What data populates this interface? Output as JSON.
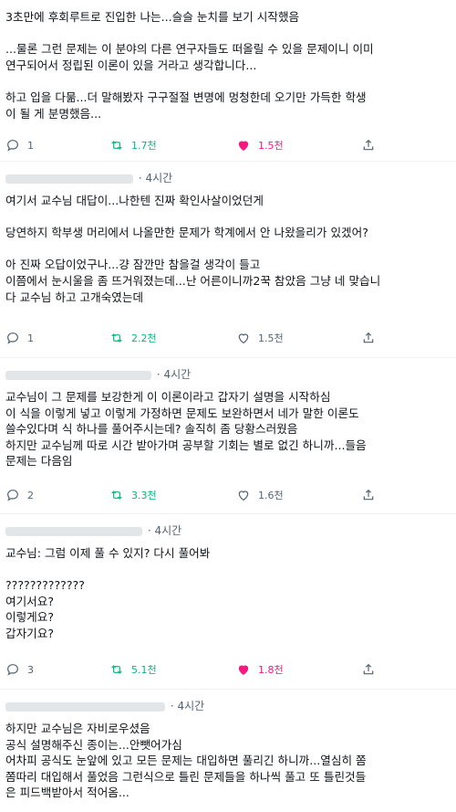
{
  "posts": [
    {
      "text": "3초만에 후회루트로 진입한 나는...슬슬 눈치를 보기 시작했음\n\n...물론 그런 문제는 이 분야의 다른 연구자들도 떠올릴 수 있을 문제이니 이미\n연구되어서 정립된 이론이 있을 거라고 생각합니다...\n\n하고 입을 다묾...더 말해봤자 구구절절 변명에 멍청한데 오기만 가득한 학생\n이 될 게 분명했음...",
      "replies": "1",
      "retweets": "1.7천",
      "likes": "1.5천",
      "liked": true
    },
    {
      "time": "· 4시간",
      "text": "여기서 교수님 대답이...나한텐 진짜 확인사살이었던게\n\n당연하지 학부생 머리에서 나올만한 문제가 학계에서 안 나왔을리가 있겠어?\n\n아 진짜 오답이었구나...걍 잠깐만 참을걸 생각이 들고\n이쯤에서 눈시울을 좀 뜨거워졌는데...난 어른이니까2꾹 참았음 그냥 네 맞습니\n다 교수님 하고 고개숙였는데",
      "replies": "1",
      "retweets": "2.2천",
      "likes": "1.5천",
      "liked": false
    },
    {
      "time": "· 4시간",
      "text": "교수님이 그 문제를 보강한게 이 이론이라고 갑자기 설명을 시작하심\n이 식을 이렇게 넣고 이렇게 가정하면 문제도 보완하면서 네가 말한 이론도\n쓸수있다며 식 하나를 풀어주시는데? 솔직히 좀 당황스러웠음\n하지만 교수님께 따로 시간 받아가며 공부할 기회는 별로 없긴 하니까...들음\n문제는 다음임",
      "replies": "2",
      "retweets": "3.3천",
      "likes": "1.6천",
      "liked": false
    },
    {
      "time": "· 4시간",
      "text": "교수님: 그럼 이제 풀 수 있지? 다시 풀어봐\n\n?????????????\n여기서요?\n이렇게요?\n갑자기요?",
      "replies": "3",
      "retweets": "5.1천",
      "likes": "1.8천",
      "liked": true
    },
    {
      "time": "· 4시간",
      "text": "하지만 교수님은 자비로우셨음\n공식 설명해주신 종이는...안뺏어가심\n어차피 공식도 눈앞에 있고 모든 문제는 대입하면 풀리긴 하니까...열심히 쫌\n쫌따리 대입해서 풀었음 그런식으로 틀린 문제들을 하나씩 풀고 또 틀린것들\n은 피드백받아서 적어옴..."
    }
  ],
  "colors": {
    "text": "#0f1419",
    "muted": "#536471",
    "retweet": "#00ba7c",
    "like": "#f91880"
  },
  "icons": {
    "reply": "reply-icon",
    "retweet": "retweet-icon",
    "like": "heart-icon",
    "share": "share-icon"
  }
}
